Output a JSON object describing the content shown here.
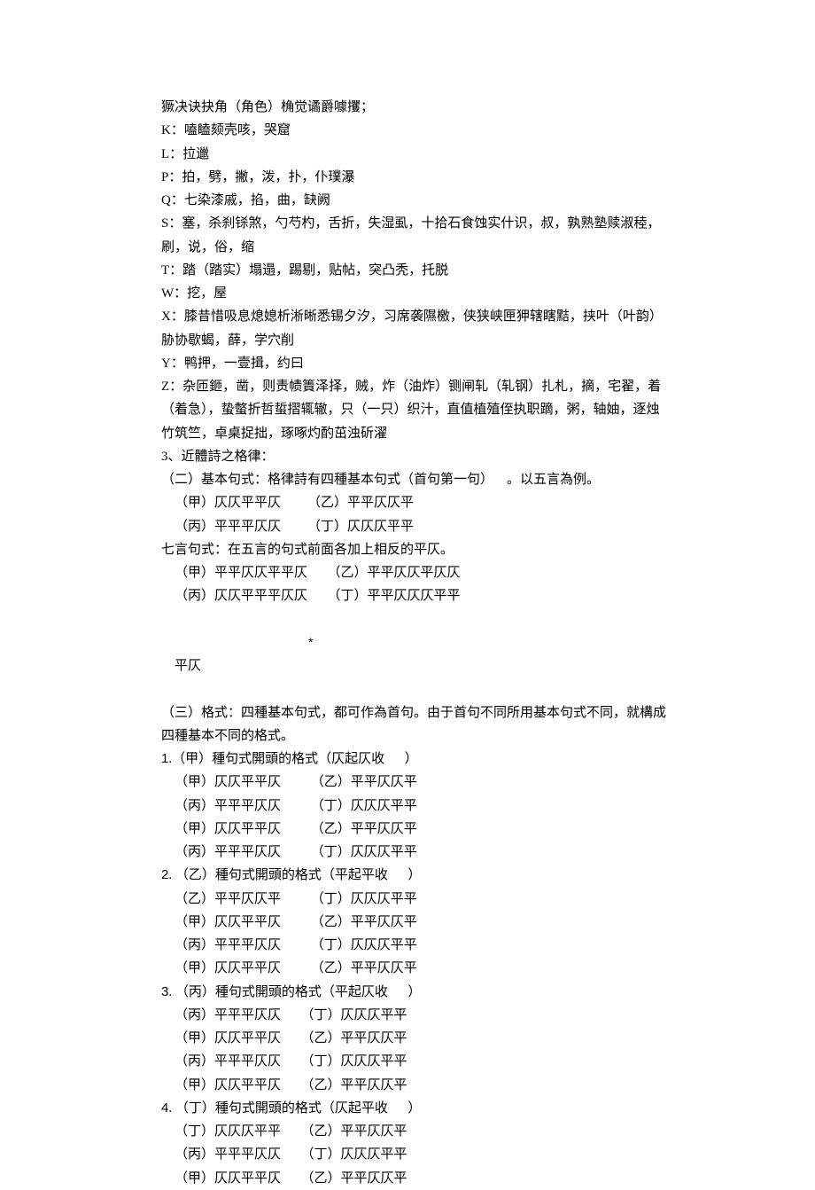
{
  "lines": {
    "l1": "獗决诀抉角（角色）桷觉谲爵噱攫；",
    "l2": "K：嗑瞌颏壳咳，哭窟",
    "l3": "L：拉邋",
    "l4": "P：拍，劈，撇，泼，扑，仆璞瀑",
    "l5": "Q：七染漆戚，掐，曲，缺阙",
    "l6": "S：塞，杀刹铩煞，勺芍杓，舌折，失湿虱，十拾石食蚀实什识，叔，孰熟塾赎淑稑，",
    "l7": "刷，说，俗，缩",
    "l8": "T：踏（踏实）塌遢，踢剔，贴帖，突凸秃，托脱",
    "l9": "W：挖，屋",
    "l10": "X：膝昔惜吸息熄媳析淅晰悉锡夕汐，习席袭隰檄，侠狭峡匣狎辖瞎黠，挟叶（叶韵）",
    "l11": "胁协歇蝎，薛，学穴削",
    "l12": "Y：鸭押，一壹揖，约曰",
    "l13": "Z：杂匝鉔，凿，则责帻簀泽择，贼，炸（油炸）铡闸轧（轧钢）扎札，摘，宅翟，着",
    "l14": "（着急），蛰螫折哲蜇摺辄辙，只（一只）织汁，直值植殖侄执职蹢，粥，轴妯，逐烛",
    "l15": "竹筑竺，卓桌捉拙，琢啄灼酌茁浊斫濯",
    "l16": "3、近體詩之格律：",
    "l17": "（二）基本句式：格律詩有四種基本句式（首句第一句）    。以五言為例。",
    "l18": "（甲）仄仄平平仄        （乙）平平仄仄平",
    "l19": "（丙）平平平仄仄        （丁）仄仄仄平平",
    "l20": "七言句式：在五言的句式前面各加上相反的平仄。",
    "l21": "（甲）平平仄仄平平仄      （乙）平平仄仄平仄仄",
    "l22": "（丙）仄仄平平平仄仄      （丁）平平仄仄仄平平",
    "l23star": "*",
    "l23": "平仄",
    "l24": "（三）格式：四種基本句式，都可作為首句。由于首句不同所用基本句式不同，就構成",
    "l25": "四種基本不同的格式。",
    "l26": "1.（甲）種句式開頭的格式（仄起仄收      ）",
    "l27": "（甲）仄仄平平仄         （乙）平平仄仄平",
    "l28": "（丙）平平平仄仄         （丁）仄仄仄平平",
    "l29": "（甲）仄仄平平仄         （乙）平平仄仄平",
    "l30": "（丙）平平平仄仄         （丁）仄仄仄平平",
    "l31": "2. （乙）種句式開頭的格式（平起平收      ）",
    "l32": "（乙）平平仄仄平         （丁）仄仄仄平平",
    "l33": "（甲）仄仄平平仄         （乙）平平仄仄平",
    "l34": "（丙）平平平仄仄         （丁）仄仄仄平平",
    "l35": "（甲）仄仄平平仄         （乙）平平仄仄平",
    "l36": "3. （丙）種句式開頭的格式（平起仄收      ）",
    "l37": "（丙）平平平仄仄      （丁）仄仄仄平平",
    "l38": "（甲）仄仄平平仄      （乙）平平仄仄平",
    "l39": "（丙）平平平仄仄      （丁）仄仄仄平平",
    "l40": "（甲）仄仄平平仄      （乙）平平仄仄平",
    "l41": "4. （丁）種句式開頭的格式（仄起平收      ）",
    "l42": "（丁）仄仄仄平平      （乙）平平仄仄平",
    "l43": "（丙）平平平仄仄      （丁）仄仄仄平平",
    "l44": "（甲）仄仄平平仄      （乙）平平仄仄平"
  }
}
